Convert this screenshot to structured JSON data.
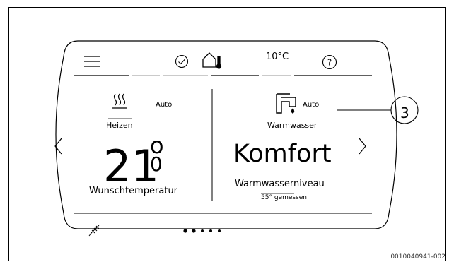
{
  "header": {
    "outside_temperature": "10°C"
  },
  "heating": {
    "mode": "Auto",
    "label": "Heizen",
    "setpoint_main": "21",
    "setpoint_sup": "o",
    "setpoint_sub": "0",
    "setpoint_label": "Wunschtemperatur"
  },
  "hot_water": {
    "mode": "Auto",
    "label": "Warmwasser",
    "value": "Komfort",
    "level_label": "Warmwasserniveau",
    "measured": "55° gemessen"
  },
  "pager": {
    "pages": 5,
    "active_pages": 2
  },
  "callout": {
    "number": "3"
  },
  "figure": {
    "id": "0010040941-002"
  },
  "icons": [
    "menu-icon",
    "check-circle-icon",
    "house-thermometer-icon",
    "help-icon",
    "heating-radiator-icon",
    "tap-icon",
    "chevron-left-icon",
    "chevron-right-icon",
    "screed-drying-icon"
  ]
}
